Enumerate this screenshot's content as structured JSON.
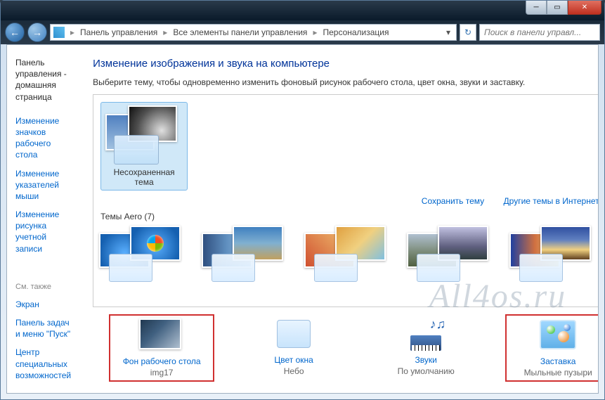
{
  "breadcrumb": {
    "items": [
      "Панель управления",
      "Все элементы панели управления",
      "Персонализация"
    ]
  },
  "search": {
    "placeholder": "Поиск в панели управл..."
  },
  "sidebar": {
    "home": "Панель управления - домашняя страница",
    "links": [
      "Изменение значков рабочего стола",
      "Изменение указателей мыши",
      "Изменение рисунка учетной записи"
    ],
    "see_also_label": "См. также",
    "see_also": [
      "Экран",
      "Панель задач и меню \"Пуск\"",
      "Центр специальных возможностей"
    ]
  },
  "main": {
    "title": "Изменение изображения и звука на компьютере",
    "desc": "Выберите тему, чтобы одновременно изменить фоновый рисунок рабочего стола, цвет окна, звуки и заставку.",
    "unsaved_theme": "Несохраненная тема",
    "save_theme": "Сохранить тему",
    "more_themes": "Другие темы в Интернете",
    "aero_label": "Темы Aero (7)"
  },
  "bottom": {
    "wallpaper": {
      "label": "Фон рабочего стола",
      "value": "img17"
    },
    "color": {
      "label": "Цвет окна",
      "value": "Небо"
    },
    "sounds": {
      "label": "Звуки",
      "value": "По умолчанию"
    },
    "saver": {
      "label": "Заставка",
      "value": "Мыльные пузыри"
    }
  },
  "watermark": "All4os.ru"
}
